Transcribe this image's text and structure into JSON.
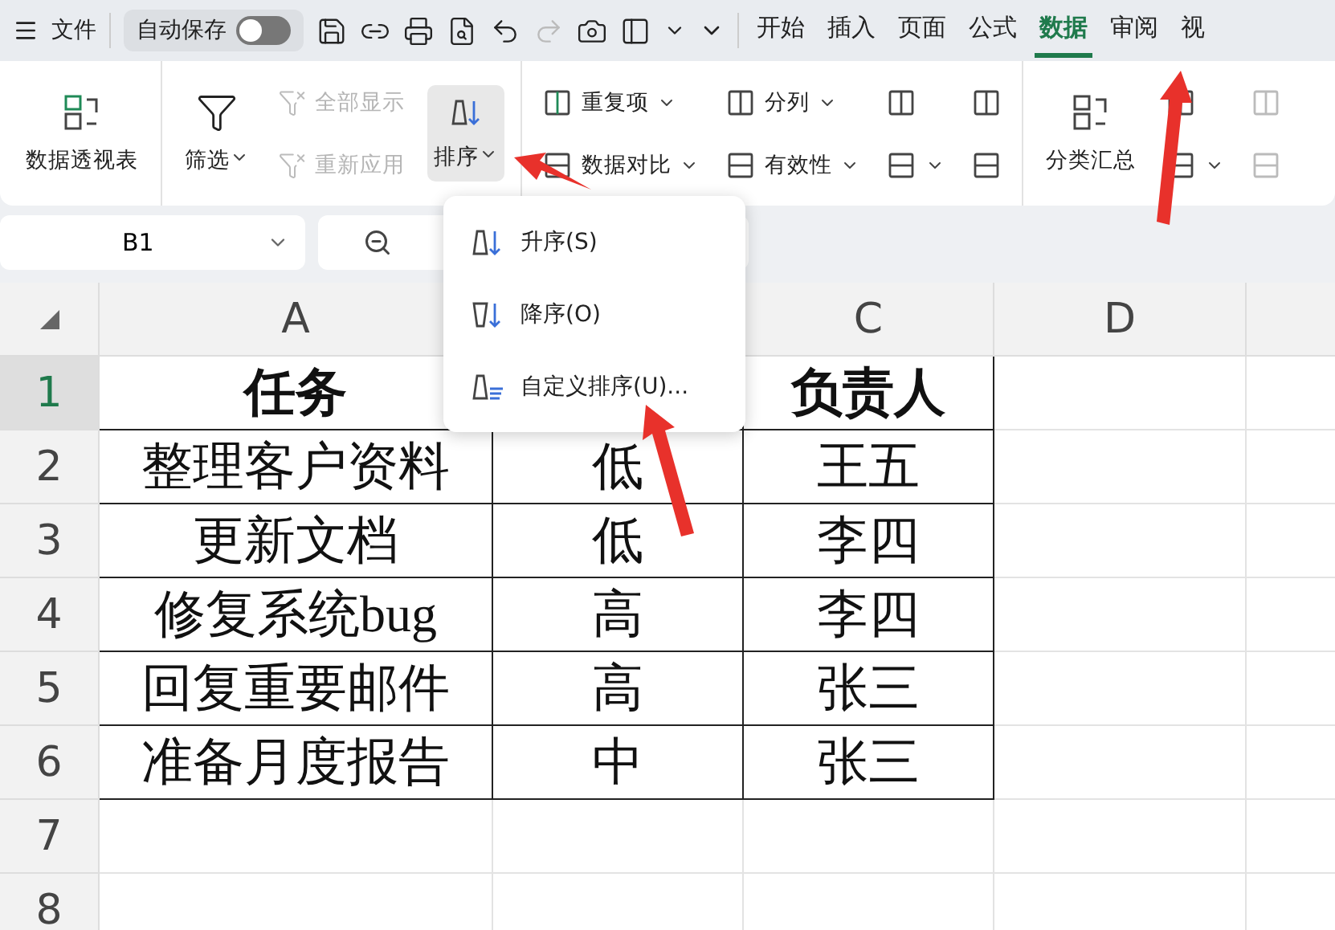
{
  "top_bar": {
    "file_label": "文件",
    "autosave": {
      "label": "自动保存",
      "on": false
    },
    "tabs": [
      {
        "label": "开始",
        "selected": false
      },
      {
        "label": "插入",
        "selected": false
      },
      {
        "label": "页面",
        "selected": false
      },
      {
        "label": "公式",
        "selected": false
      },
      {
        "label": "数据",
        "selected": true
      },
      {
        "label": "审阅",
        "selected": false
      },
      {
        "label": "视",
        "selected": false
      }
    ]
  },
  "ribbon": {
    "columns": [
      {
        "items": [
          {
            "kind": "large",
            "label": "数据透视表",
            "disabled": false,
            "dropdown": false,
            "active": false
          }
        ]
      },
      {
        "items": [
          {
            "kind": "large",
            "label": "筛选",
            "disabled": false,
            "dropdown": true,
            "active": false
          }
        ]
      },
      {
        "items": [
          {
            "kind": "small",
            "label": "全部显示",
            "disabled": true,
            "dropdown": false
          },
          {
            "kind": "small",
            "label": "重新应用",
            "disabled": true,
            "dropdown": false
          }
        ]
      },
      {
        "items": [
          {
            "kind": "large",
            "label": "排序",
            "disabled": false,
            "dropdown": true,
            "active": true
          }
        ]
      },
      {
        "items": [
          {
            "kind": "small",
            "label": "重复项",
            "disabled": false,
            "dropdown": true
          },
          {
            "kind": "small",
            "label": "数据对比",
            "disabled": false,
            "dropdown": true
          }
        ]
      },
      {
        "items": [
          {
            "kind": "small",
            "label": "分列",
            "disabled": false,
            "dropdown": true
          },
          {
            "kind": "small",
            "label": "有效性",
            "disabled": false,
            "dropdown": true
          }
        ]
      },
      {
        "items": [
          {
            "kind": "icon",
            "disabled": false,
            "dropdown": false
          },
          {
            "kind": "icon",
            "disabled": false,
            "dropdown": true
          }
        ]
      },
      {
        "items": [
          {
            "kind": "icon",
            "disabled": false,
            "dropdown": false
          },
          {
            "kind": "icon",
            "disabled": false,
            "dropdown": false
          }
        ]
      },
      {
        "items": [
          {
            "kind": "large",
            "label": "分类汇总",
            "disabled": false,
            "dropdown": false,
            "active": false
          }
        ]
      },
      {
        "items": [
          {
            "kind": "icon",
            "disabled": false,
            "dropdown": false
          },
          {
            "kind": "icon",
            "disabled": false,
            "dropdown": true
          }
        ]
      },
      {
        "items": [
          {
            "kind": "icon",
            "disabled": true,
            "dropdown": false
          },
          {
            "kind": "icon",
            "disabled": true,
            "dropdown": false
          }
        ]
      }
    ]
  },
  "name_box": {
    "value": "B1"
  },
  "sort_menu": {
    "items": [
      {
        "label": "升序(S)"
      },
      {
        "label": "降序(O)"
      },
      {
        "label": "自定义排序(U)..."
      }
    ]
  },
  "sheet": {
    "columns": [
      {
        "label": "A"
      },
      {},
      {
        "label": "C"
      },
      {
        "label": "D"
      },
      {}
    ],
    "rows": [
      {
        "number": "1",
        "selected": true,
        "cells": [
          "任务",
          null,
          "负责人"
        ]
      },
      {
        "number": "2",
        "selected": false,
        "cells": [
          "整理客户资料",
          "低",
          "王五"
        ]
      },
      {
        "number": "3",
        "selected": false,
        "cells": [
          "更新文档",
          "低",
          "李四"
        ]
      },
      {
        "number": "4",
        "selected": false,
        "cells": [
          "修复系统bug",
          "高",
          "李四"
        ]
      },
      {
        "number": "5",
        "selected": false,
        "cells": [
          "回复重要邮件",
          "高",
          "张三"
        ]
      },
      {
        "number": "6",
        "selected": false,
        "cells": [
          "准备月度报告",
          "中",
          "张三"
        ]
      },
      {
        "number": "7",
        "selected": false,
        "cells": []
      },
      {
        "number": "8",
        "selected": false,
        "cells": []
      }
    ]
  }
}
